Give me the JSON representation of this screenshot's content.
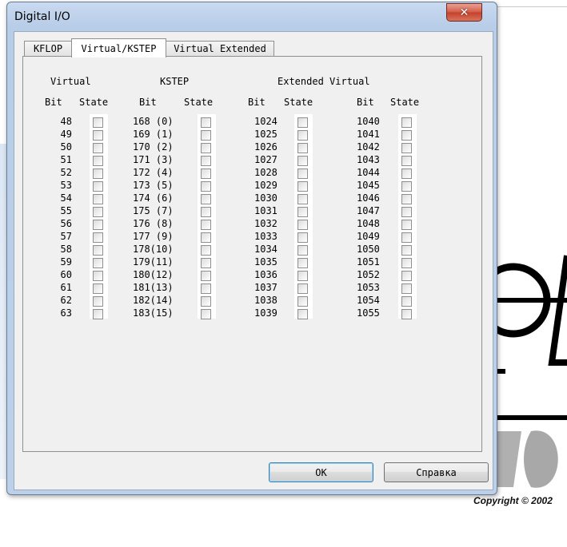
{
  "window": {
    "title": "Digital I/O"
  },
  "tabs": [
    {
      "label": "KFLOP",
      "active": false
    },
    {
      "label": "Virtual/KSTEP",
      "active": true
    },
    {
      "label": "Virtual Extended",
      "active": false
    }
  ],
  "groups": {
    "virtual": {
      "title": "Virtual"
    },
    "kstep": {
      "title": "KSTEP"
    },
    "extended": {
      "title": "Extended Virtual"
    }
  },
  "headers": {
    "bit": "Bit",
    "state": "State"
  },
  "columns": {
    "virtual_bits": [
      "48",
      "49",
      "50",
      "51",
      "52",
      "53",
      "54",
      "55",
      "56",
      "57",
      "58",
      "59",
      "60",
      "61",
      "62",
      "63"
    ],
    "kstep_bits": [
      "168 (0)",
      "169 (1)",
      "170 (2)",
      "171 (3)",
      "172 (4)",
      "173 (5)",
      "174 (6)",
      "175 (7)",
      "176 (8)",
      "177 (9)",
      "178(10)",
      "179(11)",
      "180(12)",
      "181(13)",
      "182(14)",
      "183(15)"
    ],
    "ext1_bits": [
      "1024",
      "1025",
      "1026",
      "1027",
      "1028",
      "1029",
      "1030",
      "1031",
      "1032",
      "1033",
      "1034",
      "1035",
      "1036",
      "1037",
      "1038",
      "1039"
    ],
    "ext2_bits": [
      "1040",
      "1041",
      "1042",
      "1043",
      "1044",
      "1045",
      "1046",
      "1047",
      "1048",
      "1049",
      "1050",
      "1051",
      "1052",
      "1053",
      "1054",
      "1055"
    ]
  },
  "buttons": {
    "ok": "OK",
    "help": "Справка"
  },
  "background": {
    "copyright": "Copyright © 2002"
  },
  "colors": {
    "close_button": "#c4402b",
    "frame": "#bcd0ea",
    "client": "#f0f0f0"
  }
}
